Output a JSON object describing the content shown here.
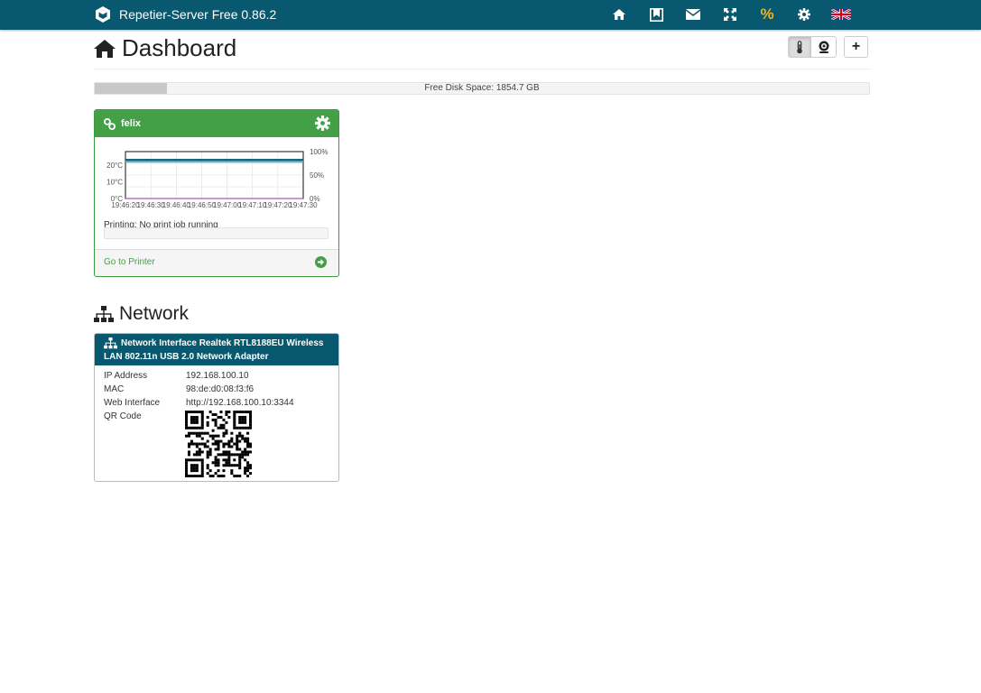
{
  "navbar": {
    "brand": "Repetier-Server Free 0.86.2",
    "icons": [
      "home-icon",
      "bookmark-icon",
      "envelope-icon",
      "fullscreen-icon",
      "percent-icon",
      "gear-icon",
      "flag-uk-icon"
    ],
    "percent_label": "%"
  },
  "page": {
    "title": "Dashboard"
  },
  "toolbar": {
    "plus_label": "+"
  },
  "disk": {
    "label": "Free Disk Space: 1854.7 GB",
    "used_fraction": 0.093
  },
  "printer": {
    "name": "felix",
    "status": "Printing: No print job running",
    "go_to": "Go to Printer",
    "chart_data": {
      "type": "line",
      "y_left_ticks": [
        "20°C",
        "10°C",
        "0°C"
      ],
      "y_right_ticks": [
        "100%",
        "50%",
        "0%"
      ],
      "x_ticks": [
        "19:46:20",
        "19:46:30",
        "19:46:40",
        "19:46:50",
        "19:47:00",
        "19:47:10",
        "19:47:20",
        "19:47:30"
      ],
      "series": [
        {
          "color": "#08596f",
          "values": [
            23,
            23,
            23,
            23,
            23,
            23,
            23,
            23
          ]
        },
        {
          "color": "#5aa9c7",
          "values": [
            22,
            22,
            22,
            22,
            22,
            22,
            22,
            22
          ]
        },
        {
          "color": "#9c27b0",
          "values": [
            0,
            0,
            0,
            0,
            0,
            0,
            0,
            0
          ]
        }
      ],
      "ylim": [
        0,
        28
      ]
    }
  },
  "network": {
    "section_title": "Network",
    "interface_title": "Network Interface Realtek RTL8188EU Wireless LAN 802.11n USB 2.0 Network Adapter",
    "rows": [
      {
        "key": "IP Address",
        "value": "192.168.100.10"
      },
      {
        "key": "MAC",
        "value": "98:de:d0:08:f3:f6"
      },
      {
        "key": "Web Interface",
        "value": "http://192.168.100.10:3344"
      },
      {
        "key": "QR Code",
        "value": ""
      }
    ]
  },
  "colors": {
    "navbar": "#08596f",
    "printer_header": "#43a047",
    "accent": "#f0b323"
  }
}
